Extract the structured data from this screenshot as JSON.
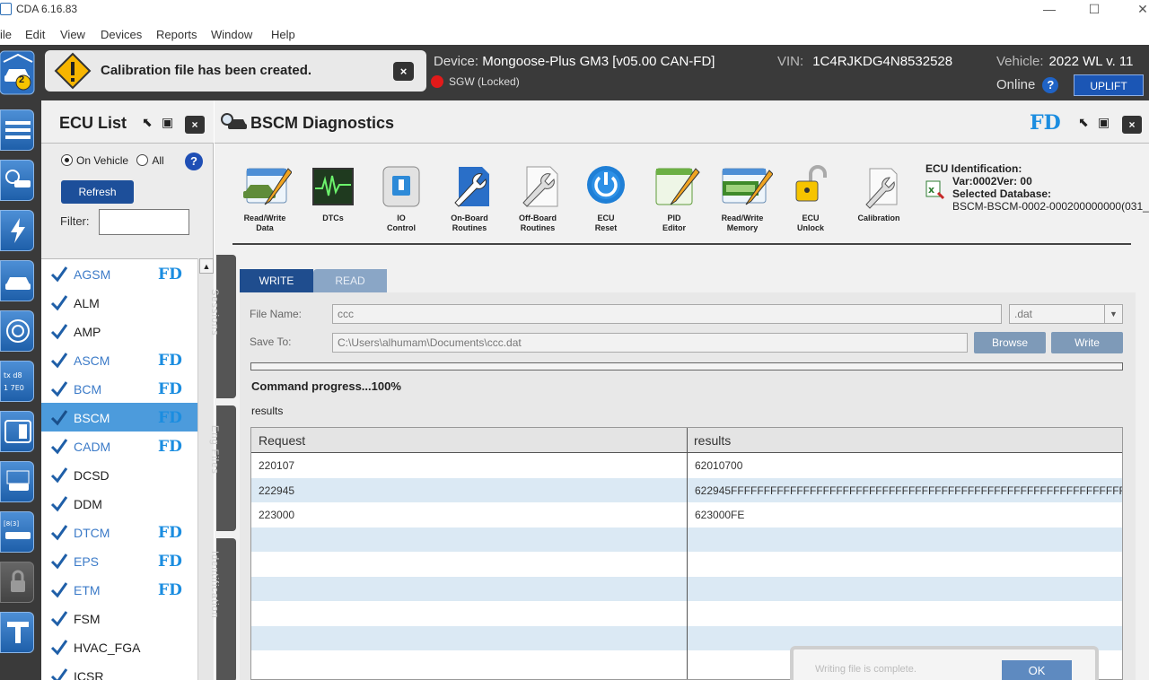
{
  "window": {
    "title": "CDA 6.16.83",
    "minimize": "—",
    "maximize": "☐",
    "close": "✕"
  },
  "menu": [
    "ile",
    "Edit",
    "View",
    "Devices",
    "Reports",
    "Window",
    "Help"
  ],
  "status": {
    "garage_badge": "2",
    "notification": "Calibration file has been created.",
    "notification_close": "×",
    "device_label": "Device:",
    "device_value": "Mongoose-Plus GM3  [v05.00 CAN-FD]",
    "sgw": "SGW (Locked)",
    "vin_label": "VIN:",
    "vin_value": "1C4RJKDG4N8532528",
    "vehicle_label": "Vehicle:",
    "vehicle_value": "2022 WL v. 11",
    "online": "Online",
    "help": "?",
    "uplift": "UPLIFT"
  },
  "ecu_panel": {
    "title": "ECU List",
    "close": "×",
    "radio_on_vehicle": "On Vehicle",
    "radio_all": "All",
    "help": "?",
    "refresh": "Refresh",
    "filter_label": "Filter:",
    "filter_value": "",
    "items": [
      {
        "name": "AGSM",
        "fd": "FD",
        "blue": true
      },
      {
        "name": "ALM",
        "fd": "",
        "blue": false
      },
      {
        "name": "AMP",
        "fd": "",
        "blue": false
      },
      {
        "name": "ASCM",
        "fd": "FD",
        "blue": true
      },
      {
        "name": "BCM",
        "fd": "FD",
        "blue": true
      },
      {
        "name": "BSCM",
        "fd": "FD",
        "blue": true,
        "selected": true
      },
      {
        "name": "CADM",
        "fd": "FD",
        "blue": true
      },
      {
        "name": "DCSD",
        "fd": "",
        "blue": false
      },
      {
        "name": "DDM",
        "fd": "",
        "blue": false
      },
      {
        "name": "DTCM",
        "fd": "FD",
        "blue": true
      },
      {
        "name": "EPS",
        "fd": "FD",
        "blue": true
      },
      {
        "name": "ETM",
        "fd": "FD",
        "blue": true
      },
      {
        "name": "FSM",
        "fd": "",
        "blue": false
      },
      {
        "name": "HVAC_FGA",
        "fd": "",
        "blue": false
      },
      {
        "name": "ICSR",
        "fd": "",
        "blue": false
      }
    ]
  },
  "main": {
    "title": "BSCM Diagnostics",
    "fd": "FD",
    "close": "×",
    "tools": [
      {
        "l1": "Read/Write",
        "l2": "Data"
      },
      {
        "l1": "DTCs",
        "l2": ""
      },
      {
        "l1": "IO",
        "l2": "Control"
      },
      {
        "l1": "On-Board",
        "l2": "Routines"
      },
      {
        "l1": "Off-Board",
        "l2": "Routines"
      },
      {
        "l1": "ECU",
        "l2": "Reset"
      },
      {
        "l1": "PID",
        "l2": "Editor"
      },
      {
        "l1": "Read/Write",
        "l2": "Memory"
      },
      {
        "l1": "ECU",
        "l2": "Unlock"
      },
      {
        "l1": "Calibration",
        "l2": ""
      }
    ],
    "ecu_ident": {
      "heading": "ECU Identification:",
      "var_line": "Var:0002Ver: 00",
      "db_heading": "Selected Database:",
      "db_value": "BSCM-BSCM-0002-000200000000(031_"
    },
    "side_tabs": [
      "Sessions",
      "Eng Files",
      "Identification"
    ],
    "tabs": {
      "write": "WRITE",
      "read": "READ"
    },
    "file_name_label": "File Name:",
    "file_name_value": "ccc",
    "extension": ".dat",
    "save_to_label": "Save To:",
    "save_to_value": "C:\\Users\\alhumam\\Documents\\ccc.dat",
    "browse": "Browse",
    "write_btn": "Write",
    "progress_percent": 100,
    "command_progress": "Command progress...100%",
    "results_label": "results",
    "grid": {
      "headers": [
        "Request",
        "results"
      ],
      "rows": [
        [
          "220107",
          "62010700"
        ],
        [
          "222945",
          "622945FFFFFFFFFFFFFFFFFFFFFFFFFFFFFFFFFFFFFFFFFFFFFFFFFFFFFFFFFFFFFFFFFFFFFFI"
        ],
        [
          "223000",
          "623000FE"
        ],
        [
          "",
          ""
        ],
        [
          "",
          ""
        ],
        [
          "",
          ""
        ],
        [
          "",
          ""
        ],
        [
          "",
          ""
        ],
        [
          "",
          ""
        ]
      ]
    }
  },
  "dialog": {
    "message": "Writing file is complete.",
    "ok": "OK"
  }
}
